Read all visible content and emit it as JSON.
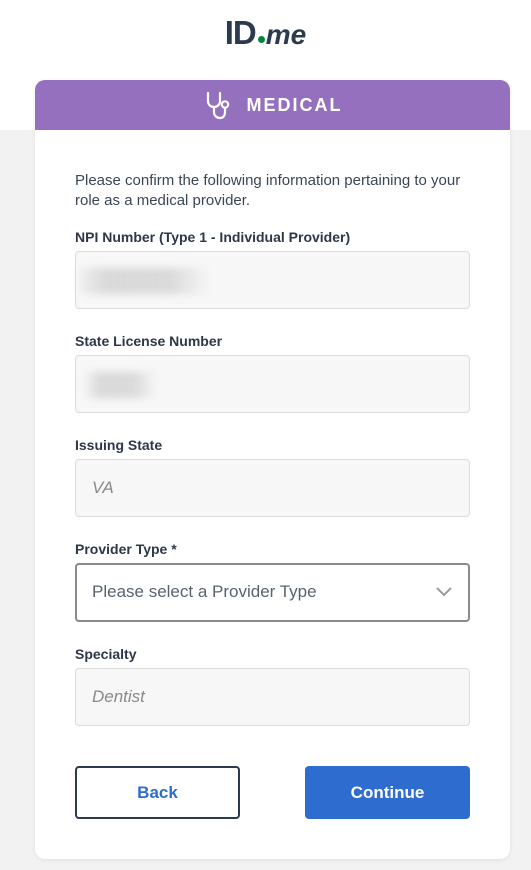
{
  "logo": {
    "id": "ID",
    "me": "me"
  },
  "header": {
    "title": "MEDICAL",
    "icon": "stethoscope-icon"
  },
  "intro": "Please confirm the following information pertaining to your role as a medical provider.",
  "fields": {
    "npi": {
      "label": "NPI Number (Type 1 - Individual Provider)"
    },
    "license": {
      "label": "State License Number"
    },
    "state": {
      "label": "Issuing State",
      "value": "VA"
    },
    "provider_type": {
      "label": "Provider Type *",
      "placeholder": "Please select a Provider Type"
    },
    "specialty": {
      "label": "Specialty",
      "value": "Dentist"
    }
  },
  "buttons": {
    "back": "Back",
    "continue": "Continue"
  },
  "colors": {
    "header": "#9470be",
    "primary": "#2f6cd0",
    "logo": "#2a3a4f",
    "logo_dot": "#08833d"
  }
}
